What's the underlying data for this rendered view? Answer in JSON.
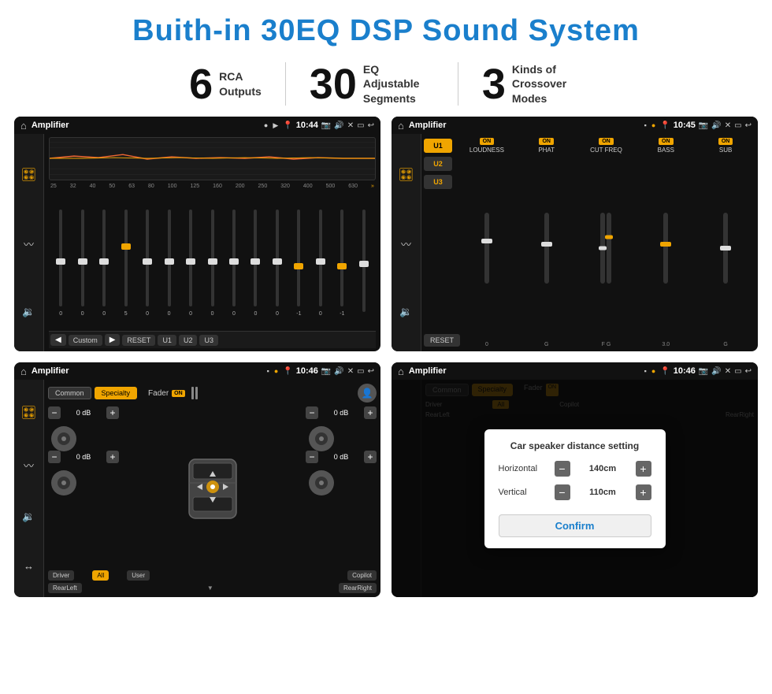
{
  "page": {
    "title": "Buith-in 30EQ DSP Sound System",
    "stats": [
      {
        "number": "6",
        "label": "RCA\nOutputs"
      },
      {
        "number": "30",
        "label": "EQ Adjustable\nSegments"
      },
      {
        "number": "3",
        "label": "Kinds of\nCrossover Modes"
      }
    ],
    "screens": [
      {
        "id": "eq-screen",
        "status_bar": {
          "title": "Amplifier",
          "time": "10:44"
        },
        "eq_bands": [
          "25",
          "32",
          "40",
          "50",
          "63",
          "80",
          "100",
          "125",
          "160",
          "200",
          "250",
          "320",
          "400",
          "500",
          "630"
        ],
        "eq_values": [
          "0",
          "0",
          "0",
          "5",
          "0",
          "0",
          "0",
          "0",
          "0",
          "0",
          "0",
          "-1",
          "0",
          "-1",
          ""
        ],
        "preset_buttons": [
          "Custom",
          "RESET",
          "U1",
          "U2",
          "U3"
        ]
      },
      {
        "id": "amp-screen",
        "status_bar": {
          "title": "Amplifier",
          "time": "10:45"
        },
        "presets": [
          "U1",
          "U2",
          "U3"
        ],
        "controls": [
          "LOUDNESS",
          "PHAT",
          "CUT FREQ",
          "BASS",
          "SUB"
        ],
        "reset_label": "RESET"
      },
      {
        "id": "fader-screen",
        "status_bar": {
          "title": "Amplifier",
          "time": "10:46"
        },
        "tabs": [
          {
            "label": "Common",
            "active": false
          },
          {
            "label": "Specialty",
            "active": true
          }
        ],
        "fader_label": "Fader",
        "on_label": "ON",
        "volumes": [
          "0 dB",
          "0 dB",
          "0 dB",
          "0 dB"
        ],
        "bottom_buttons": [
          "Driver",
          "RearLeft",
          "All",
          "Copilot",
          "User",
          "RearRight"
        ]
      },
      {
        "id": "dialog-screen",
        "status_bar": {
          "title": "Amplifier",
          "time": "10:46"
        },
        "dialog": {
          "title": "Car speaker distance setting",
          "fields": [
            {
              "label": "Horizontal",
              "value": "140cm"
            },
            {
              "label": "Vertical",
              "value": "110cm"
            }
          ],
          "confirm_label": "Confirm"
        }
      }
    ]
  }
}
